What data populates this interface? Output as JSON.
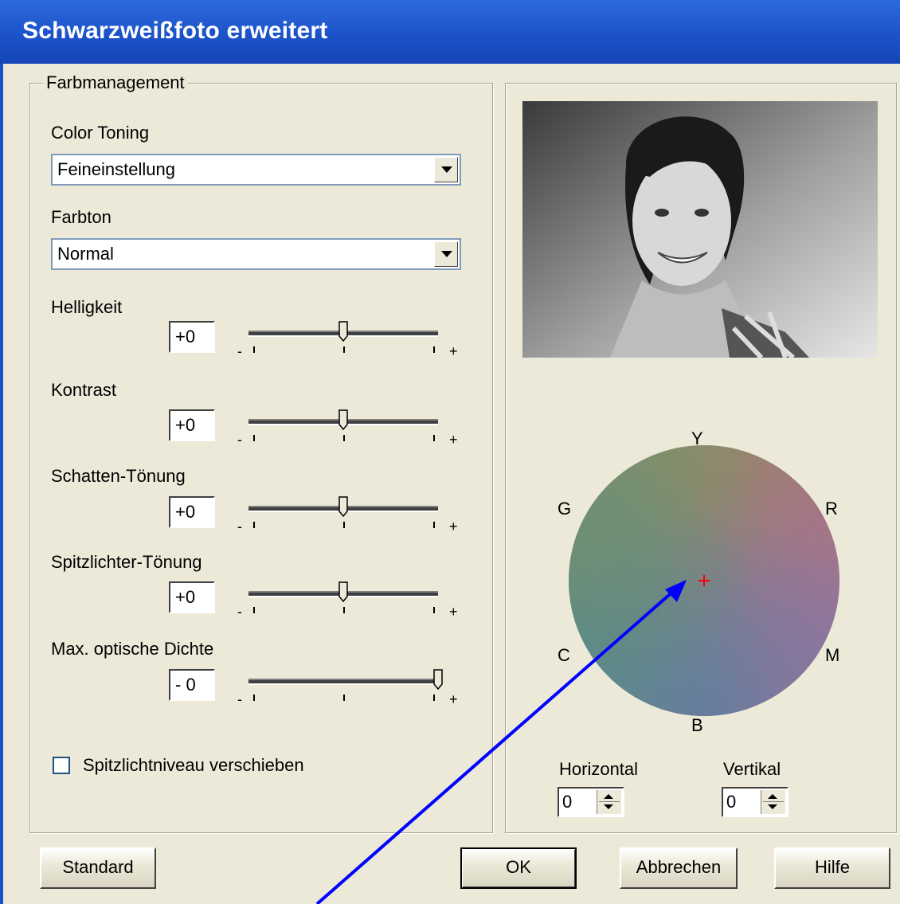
{
  "window": {
    "title": "Schwarzweißfoto erweitert"
  },
  "color_management": {
    "group_label": "Farbmanagement",
    "color_toning": {
      "label": "Color Toning",
      "value": "Feineinstellung"
    },
    "hue": {
      "label": "Farbton",
      "value": "Normal"
    },
    "sliders": [
      {
        "label": "Helligkeit",
        "value": "+0",
        "min_label": "-",
        "max_label": "+",
        "position": 0.5
      },
      {
        "label": "Kontrast",
        "value": "+0",
        "min_label": "-",
        "max_label": "+",
        "position": 0.5
      },
      {
        "label": "Schatten-Tönung",
        "value": "+0",
        "min_label": "-",
        "max_label": "+",
        "position": 0.5
      },
      {
        "label": "Spitzlichter-Tönung",
        "value": "+0",
        "min_label": "-",
        "max_label": "+",
        "position": 0.5
      },
      {
        "label": "Max. optische Dichte",
        "value": "- 0",
        "min_label": "-",
        "max_label": "+",
        "position": 1.0
      }
    ],
    "highlight_shift": {
      "label": "Spitzlichtniveau verschieben",
      "checked": false
    }
  },
  "color_wheel": {
    "labels": {
      "top": "Y",
      "upper_left": "G",
      "upper_right": "R",
      "lower_left": "C",
      "lower_right": "M",
      "bottom": "B"
    },
    "horizontal": {
      "label": "Horizontal",
      "value": "0"
    },
    "vertical": {
      "label": "Vertikal",
      "value": "0"
    }
  },
  "buttons": {
    "standard": "Standard",
    "ok": "OK",
    "cancel": "Abbrechen",
    "help": "Hilfe"
  },
  "colors": {
    "titlebar": "#1c52c9",
    "dialog_bg": "#ece9d8",
    "annotation_arrow": "#0000ff",
    "center_marker": "#ff0000"
  }
}
